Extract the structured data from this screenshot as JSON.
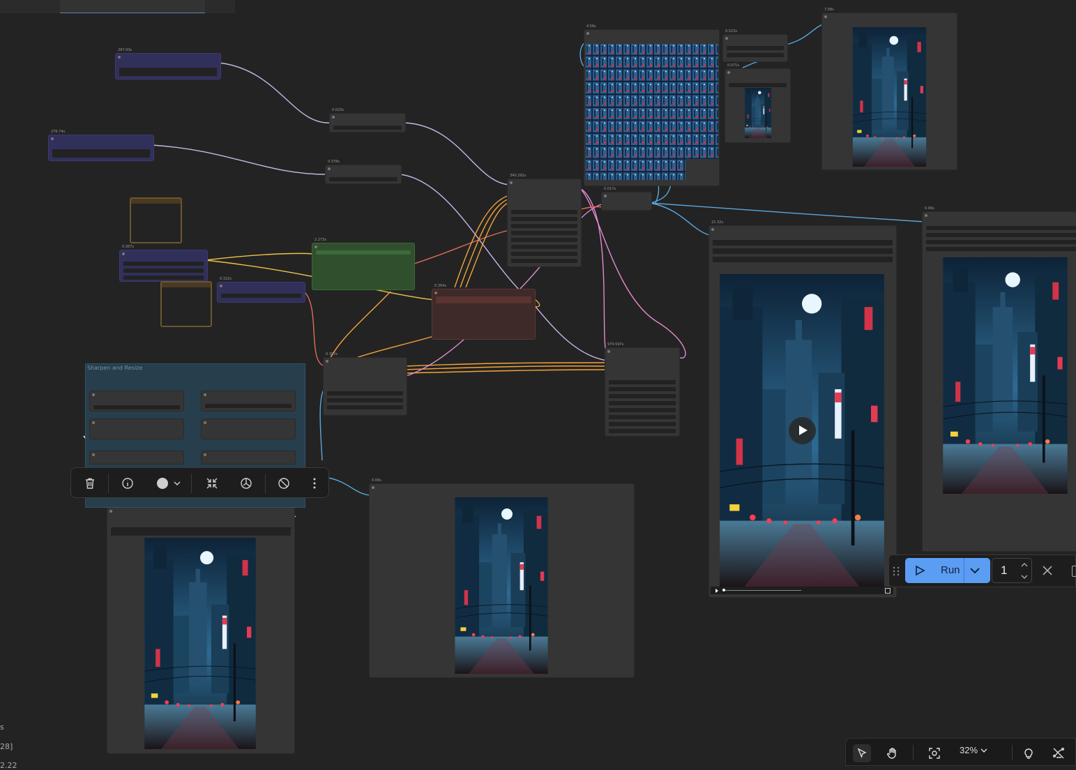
{
  "group": {
    "title": "Sharpen and Resize"
  },
  "toolbar": {
    "items": [
      "delete",
      "info",
      "color",
      "collapse",
      "bypass",
      "mute",
      "more"
    ]
  },
  "runbar": {
    "run_label": "Run",
    "count": "1"
  },
  "zoom": {
    "label": "32%"
  },
  "sidebar_fragments": [
    "s",
    "28]",
    "2.22"
  ],
  "colors": {
    "canvas": "#232323",
    "run_button": "#5b9df2",
    "link_purple": "#c9b6e6",
    "link_yellow": "#f0c24a",
    "link_orange": "#f3a43c",
    "link_pink": "#e38ad1",
    "link_blue": "#5aa7dd",
    "link_red": "#e56b5c"
  }
}
